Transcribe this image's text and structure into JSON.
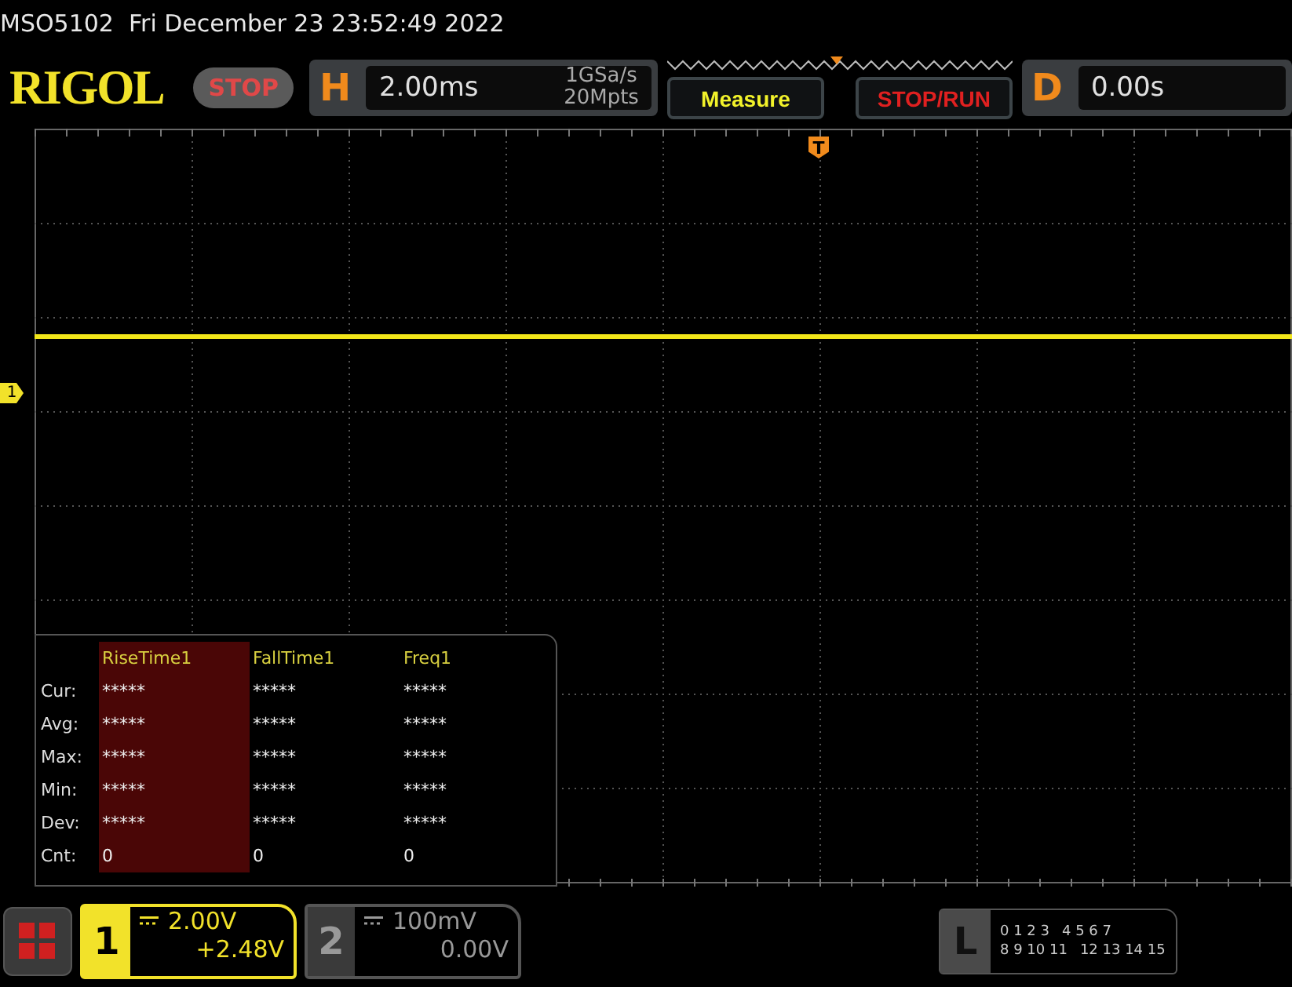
{
  "header": {
    "model": "MSO5102",
    "datetime": "Fri December 23 23:52:49 2022"
  },
  "toolbar": {
    "logo": "RIGOL",
    "run_state": "STOP",
    "horizontal": {
      "label": "H",
      "timebase": "2.00ms",
      "sample_rate": "1GSa/s",
      "memory_depth": "20Mpts"
    },
    "buttons": [
      {
        "label": "Measure",
        "kind": "measure"
      },
      {
        "label": "STOP/RUN",
        "kind": "run"
      }
    ],
    "delay": {
      "label": "D",
      "value": "0.00s"
    }
  },
  "trigger_marker": "T",
  "channel_marker": "1",
  "measurements": {
    "columns": [
      {
        "name": "RiseTime1",
        "selected": true
      },
      {
        "name": "FallTime1",
        "selected": false
      },
      {
        "name": "Freq1",
        "selected": false
      }
    ],
    "rows": [
      {
        "label": "Cur:",
        "values": [
          "*****",
          "*****",
          "*****"
        ]
      },
      {
        "label": "Avg:",
        "values": [
          "*****",
          "*****",
          "*****"
        ]
      },
      {
        "label": "Max:",
        "values": [
          "*****",
          "*****",
          "*****"
        ]
      },
      {
        "label": "Min:",
        "values": [
          "*****",
          "*****",
          "*****"
        ]
      },
      {
        "label": "Dev:",
        "values": [
          "*****",
          "*****",
          "*****"
        ]
      },
      {
        "label": "Cnt:",
        "values": [
          "0",
          "0",
          "0"
        ]
      }
    ]
  },
  "channels": [
    {
      "number": "1",
      "scale": "2.00V",
      "offset": "+2.48V",
      "selected": true
    },
    {
      "number": "2",
      "scale": "100mV",
      "offset": "0.00V",
      "selected": false
    }
  ],
  "logic": {
    "label": "L",
    "rows": [
      [
        "0 1 2 3",
        "4 5 6 7"
      ],
      [
        "8 9 10 11",
        "12 13 14 15"
      ]
    ]
  }
}
